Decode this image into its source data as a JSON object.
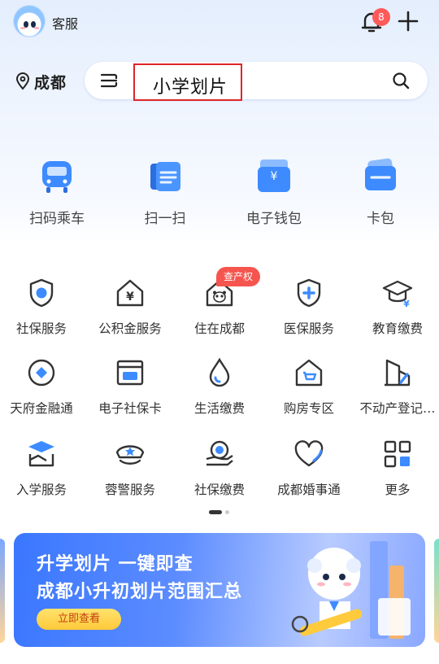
{
  "header": {
    "service_label": "客服",
    "notification_count": "8"
  },
  "location": {
    "city": "成都"
  },
  "search": {
    "query": "小学划片"
  },
  "main_actions": [
    {
      "label": "扫码乘车",
      "icon": "bus-icon"
    },
    {
      "label": "扫一扫",
      "icon": "scan-icon"
    },
    {
      "label": "电子钱包",
      "icon": "wallet-icon"
    },
    {
      "label": "卡包",
      "icon": "card-icon"
    }
  ],
  "services": [
    {
      "label": "社保服务",
      "icon": "social-security-shield-icon"
    },
    {
      "label": "公积金服务",
      "icon": "housing-fund-icon"
    },
    {
      "label": "住在成都",
      "icon": "panda-house-icon"
    },
    {
      "label": "医保服务",
      "icon": "medical-shield-icon"
    },
    {
      "label": "教育缴费",
      "icon": "graduation-cap-icon"
    },
    {
      "label": "天府金融通",
      "icon": "finance-diamond-icon"
    },
    {
      "label": "电子社保卡",
      "icon": "social-card-icon"
    },
    {
      "label": "生活缴费",
      "icon": "water-drop-icon"
    },
    {
      "label": "购房专区",
      "icon": "house-cart-icon"
    },
    {
      "label": "不动产登记…",
      "icon": "property-building-icon"
    },
    {
      "label": "入学服务",
      "icon": "school-enroll-icon"
    },
    {
      "label": "蓉警服务",
      "icon": "police-cap-icon"
    },
    {
      "label": "社保缴费",
      "icon": "social-pay-icon"
    },
    {
      "label": "成都婚事通",
      "icon": "heart-icon"
    },
    {
      "label": "更多",
      "icon": "more-grid-icon"
    }
  ],
  "service_tag": "查产权",
  "banner": {
    "line1": "升学划片 一键即查",
    "line2": "成都小升初划片范围汇总",
    "button": "立即查看"
  },
  "colors": {
    "accent": "#2f6bff",
    "badge": "#ff5a5a",
    "highlight_border": "#e0242a"
  }
}
